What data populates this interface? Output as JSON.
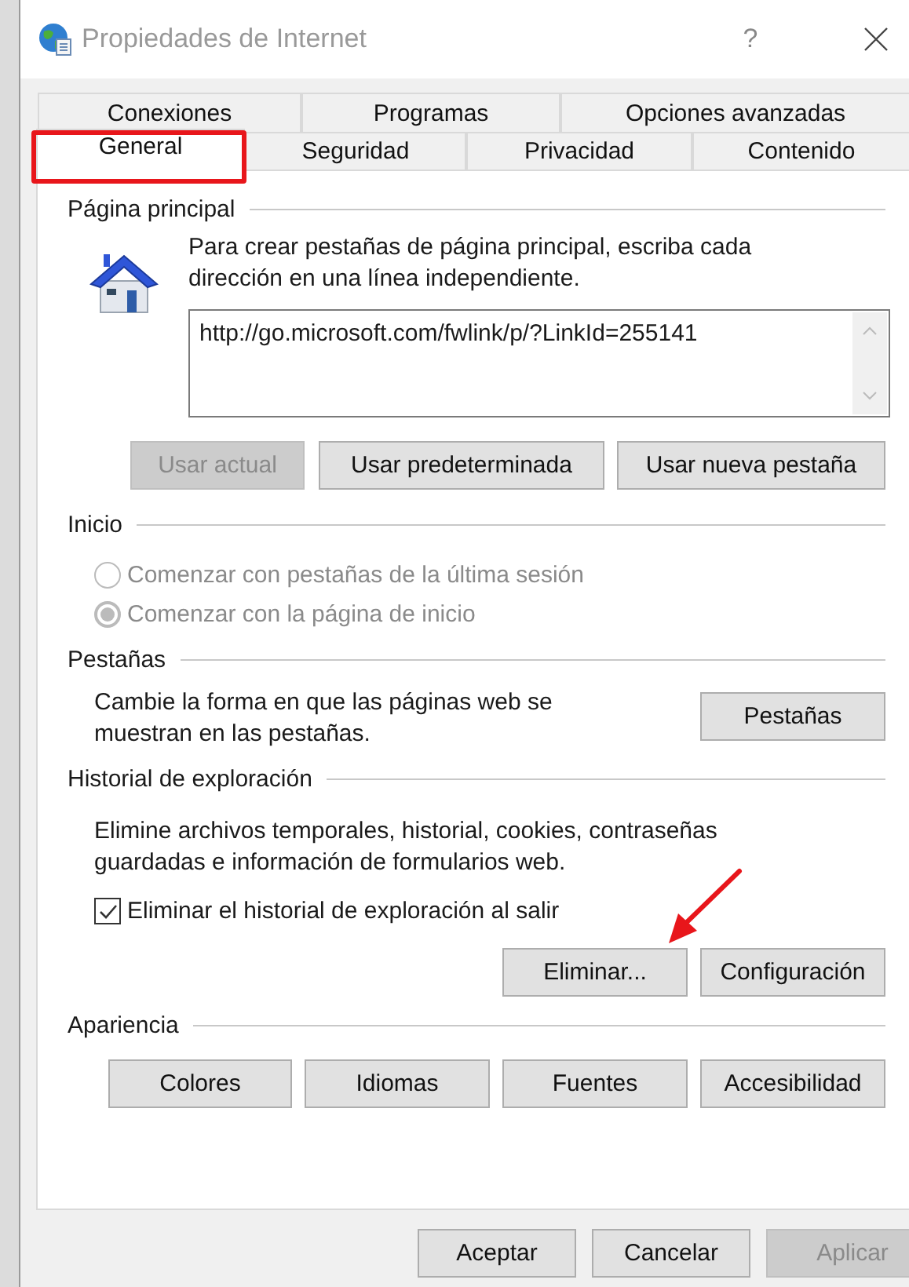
{
  "window": {
    "title": "Propiedades de Internet",
    "help": "?"
  },
  "tabs": [
    [
      {
        "label": "Conexiones",
        "selected": false
      },
      {
        "label": "Programas",
        "selected": false
      },
      {
        "label": "Opciones avanzadas",
        "selected": false
      }
    ],
    [
      {
        "label": "General",
        "selected": true
      },
      {
        "label": "Seguridad",
        "selected": false
      },
      {
        "label": "Privacidad",
        "selected": false
      },
      {
        "label": "Contenido",
        "selected": false
      }
    ]
  ],
  "home_page": {
    "heading": "Página principal",
    "description": "Para crear pestañas de página principal, escriba cada dirección en una línea independiente.",
    "url": "http://go.microsoft.com/fwlink/p/?LinkId=255141",
    "buttons": [
      {
        "label": "Usar actual",
        "disabled": true
      },
      {
        "label": "Usar predeterminada",
        "disabled": false
      },
      {
        "label": "Usar nueva pestaña",
        "disabled": false
      }
    ]
  },
  "startup": {
    "heading": "Inicio",
    "options": [
      {
        "label": "Comenzar con pestañas de la última sesión",
        "selected": false,
        "disabled": true
      },
      {
        "label": "Comenzar con la página de inicio",
        "selected": true,
        "disabled": true
      }
    ]
  },
  "tabs_section": {
    "heading": "Pestañas",
    "description": "Cambie la forma en que las páginas web se muestran en las pestañas.",
    "button": "Pestañas"
  },
  "history": {
    "heading": "Historial de exploración",
    "description": "Elimine archivos temporales, historial, cookies, contraseñas guardadas e información de formularios web.",
    "checkbox": {
      "label": "Eliminar el historial de exploración al salir",
      "checked": true
    },
    "buttons": [
      {
        "label": "Eliminar...",
        "disabled": false
      },
      {
        "label": "Configuración",
        "disabled": false
      }
    ]
  },
  "appearance": {
    "heading": "Apariencia",
    "buttons": [
      {
        "label": "Colores",
        "disabled": false
      },
      {
        "label": "Idiomas",
        "disabled": false
      },
      {
        "label": "Fuentes",
        "disabled": false
      },
      {
        "label": "Accesibilidad",
        "disabled": false
      }
    ]
  },
  "footer_buttons": [
    {
      "label": "Aceptar",
      "disabled": false
    },
    {
      "label": "Cancelar",
      "disabled": false
    },
    {
      "label": "Aplicar",
      "disabled": true
    }
  ],
  "annotations": {
    "highlight_box": {
      "color": "#e8161b"
    },
    "arrow": {
      "color": "#e8161b"
    }
  }
}
